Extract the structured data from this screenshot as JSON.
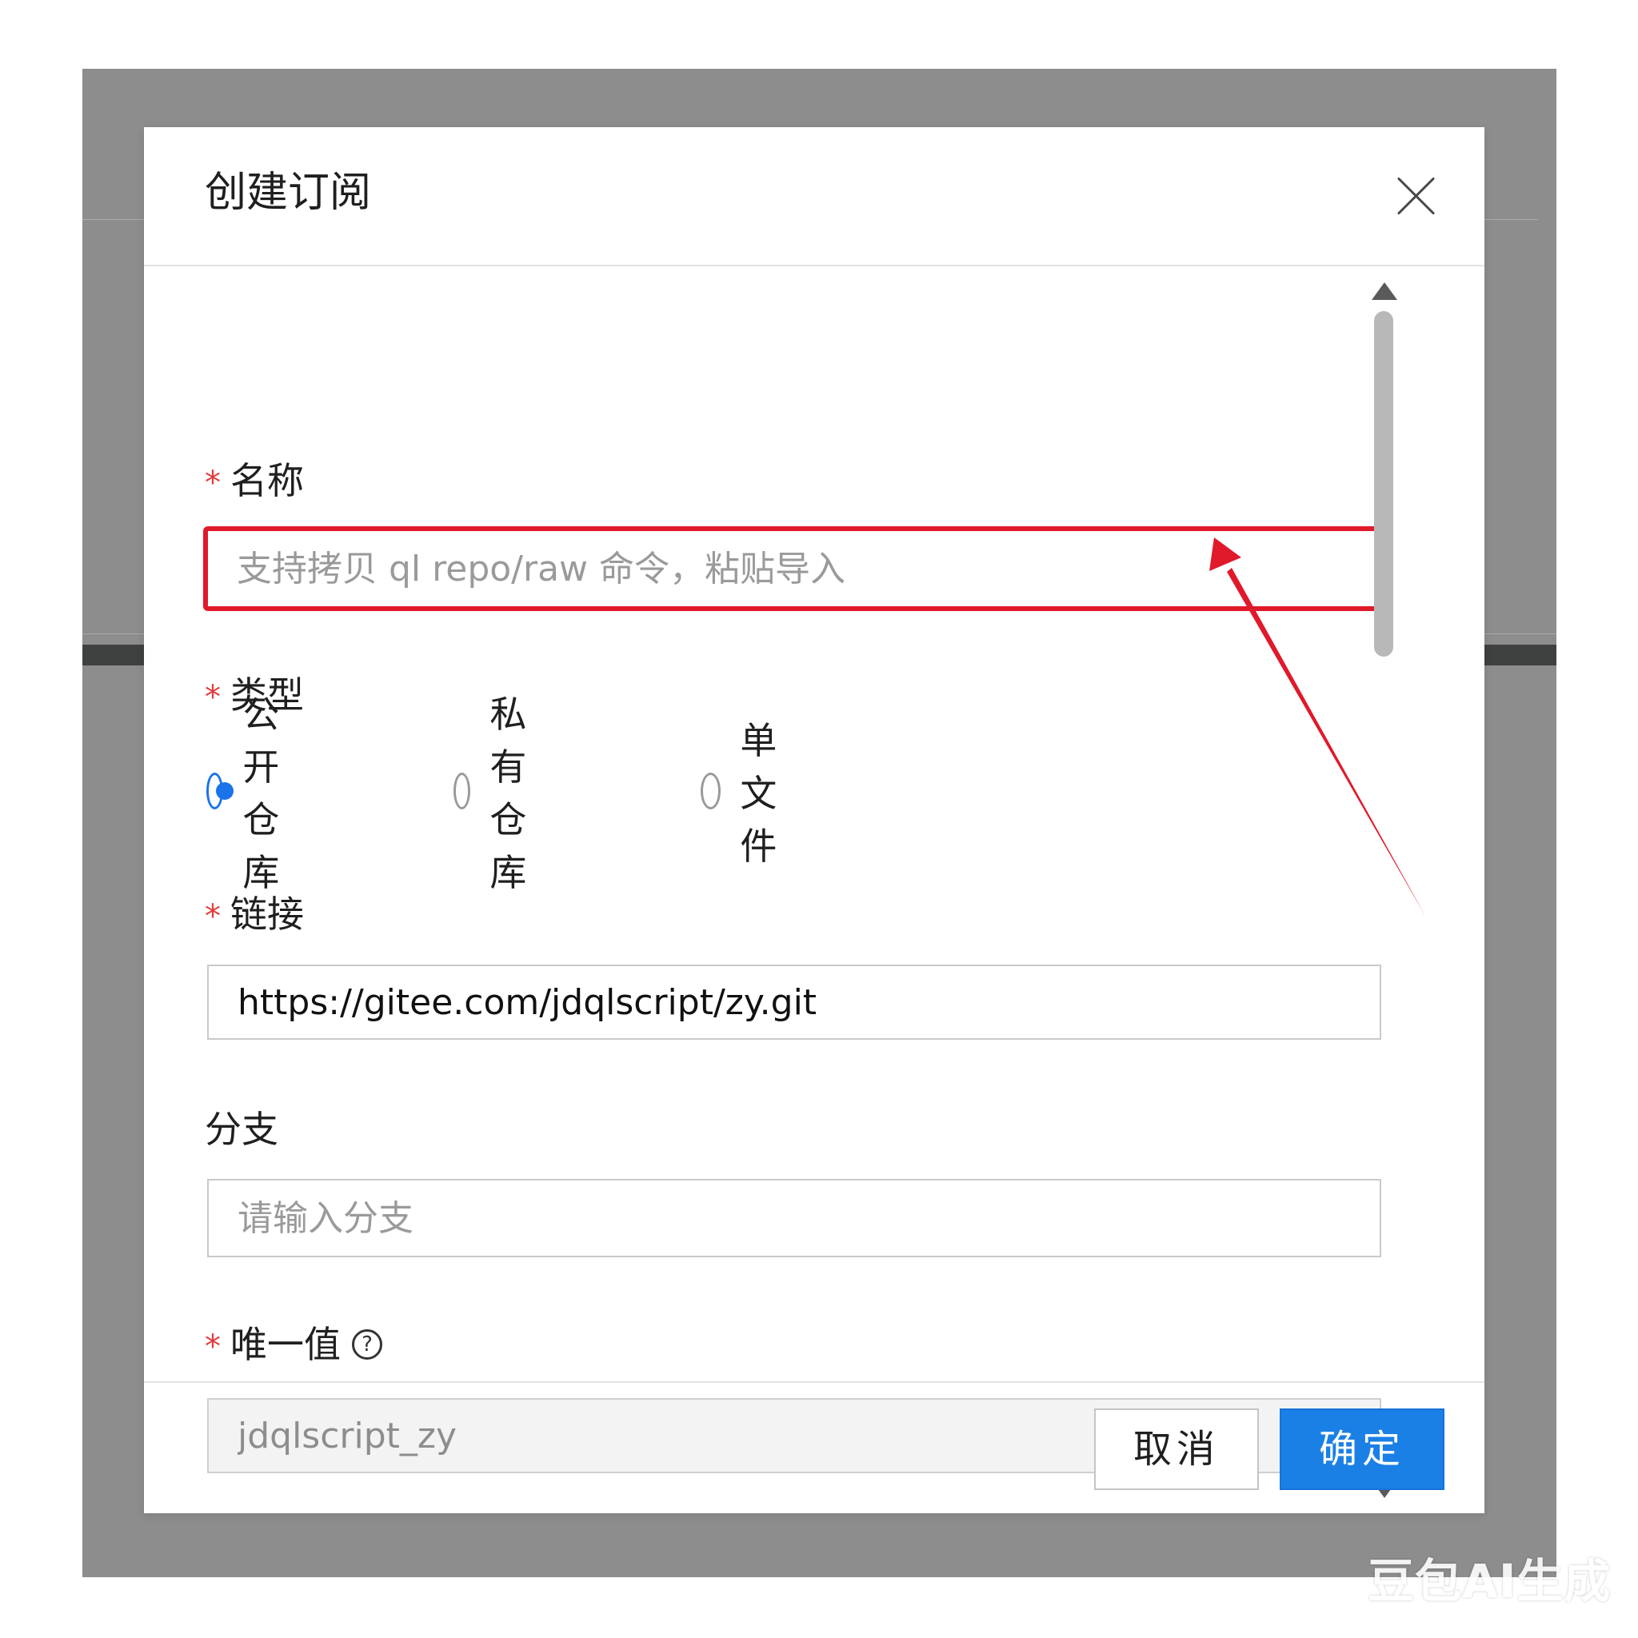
{
  "dialog": {
    "title": "创建订阅"
  },
  "form": {
    "name": {
      "required_mark": "*",
      "label": "名称",
      "placeholder": "支持拷贝 ql repo/raw 命令，粘贴导入",
      "value": ""
    },
    "type": {
      "required_mark": "*",
      "label": "类型",
      "options": [
        {
          "label": "公开仓库",
          "checked": true
        },
        {
          "label": "私有仓库",
          "checked": false
        },
        {
          "label": "单文件",
          "checked": false
        }
      ]
    },
    "link": {
      "required_mark": "*",
      "label": "链接",
      "value": "https://gitee.com/jdqlscript/zy.git"
    },
    "branch": {
      "label": "分支",
      "placeholder": "请输入分支",
      "value": ""
    },
    "unique": {
      "required_mark": "*",
      "label": "唯一值",
      "help_icon": "?",
      "value": "jdqlscript_zy"
    }
  },
  "footer": {
    "cancel_label": "取消",
    "ok_label": "确定"
  },
  "colors": {
    "highlight": "#e0192b",
    "primary": "#1a80e6",
    "required": "#e23b3b",
    "backdrop": "#8c8d8c"
  },
  "icons": {
    "close": "close-icon",
    "help": "question-circle-icon",
    "scroll_up": "triangle-up-icon",
    "scroll_down": "triangle-down-icon"
  },
  "watermark": "豆包AI生成"
}
